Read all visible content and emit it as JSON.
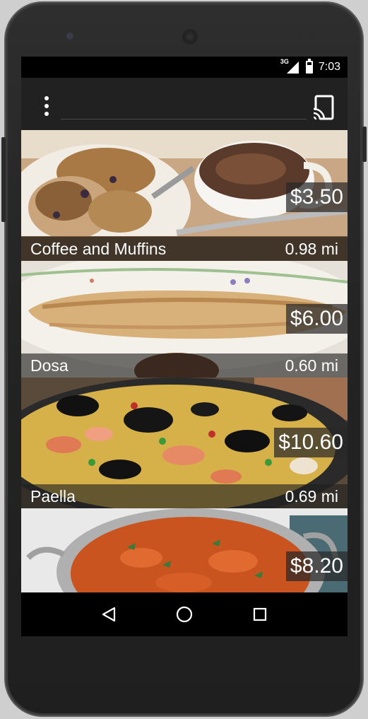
{
  "status": {
    "network": "3G",
    "time": "7:03"
  },
  "actionbar": {
    "menu_icon": "overflow-menu-icon",
    "cast_icon": "cast-icon"
  },
  "items": [
    {
      "name": "Coffee and Muffins",
      "price": "$3.50",
      "distance": "0.98 mi",
      "image": "coffee-muffins"
    },
    {
      "name": "Dosa",
      "price": "$6.00",
      "distance": "0.60 mi",
      "image": "dosa"
    },
    {
      "name": "Paella",
      "price": "$10.60",
      "distance": "0.69 mi",
      "image": "paella"
    },
    {
      "name": "",
      "price": "$8.20",
      "distance": "",
      "image": "curry"
    }
  ],
  "navigation": {
    "back_icon": "back-triangle-icon",
    "home_icon": "home-circle-icon",
    "recents_icon": "recents-square-icon"
  },
  "colors": {
    "actionbar": "#212121",
    "statusbar": "#000000",
    "overlay": "#1e1e1e"
  }
}
